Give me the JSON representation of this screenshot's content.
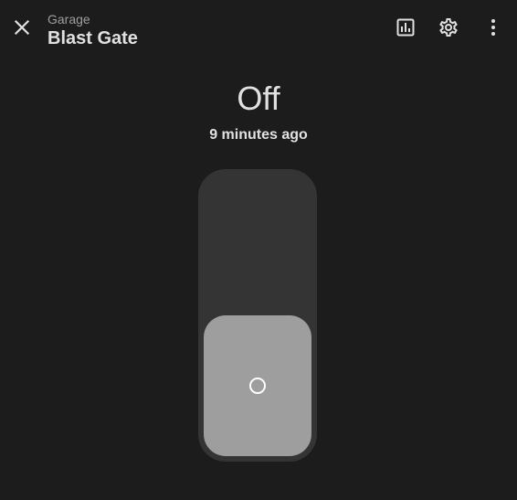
{
  "header": {
    "breadcrumb": "Garage",
    "title": "Blast Gate",
    "icons": {
      "close": "close-icon",
      "history": "chart-box-icon",
      "settings": "gear-icon",
      "more": "dots-vertical-icon"
    }
  },
  "state": {
    "value": "Off",
    "last_changed": "9 minutes ago",
    "is_on": false
  },
  "colors": {
    "background": "#1c1c1c",
    "track": "#343434",
    "knob_off": "#9e9e9e",
    "text": "#e1e1e1",
    "muted": "#9e9e9e"
  }
}
